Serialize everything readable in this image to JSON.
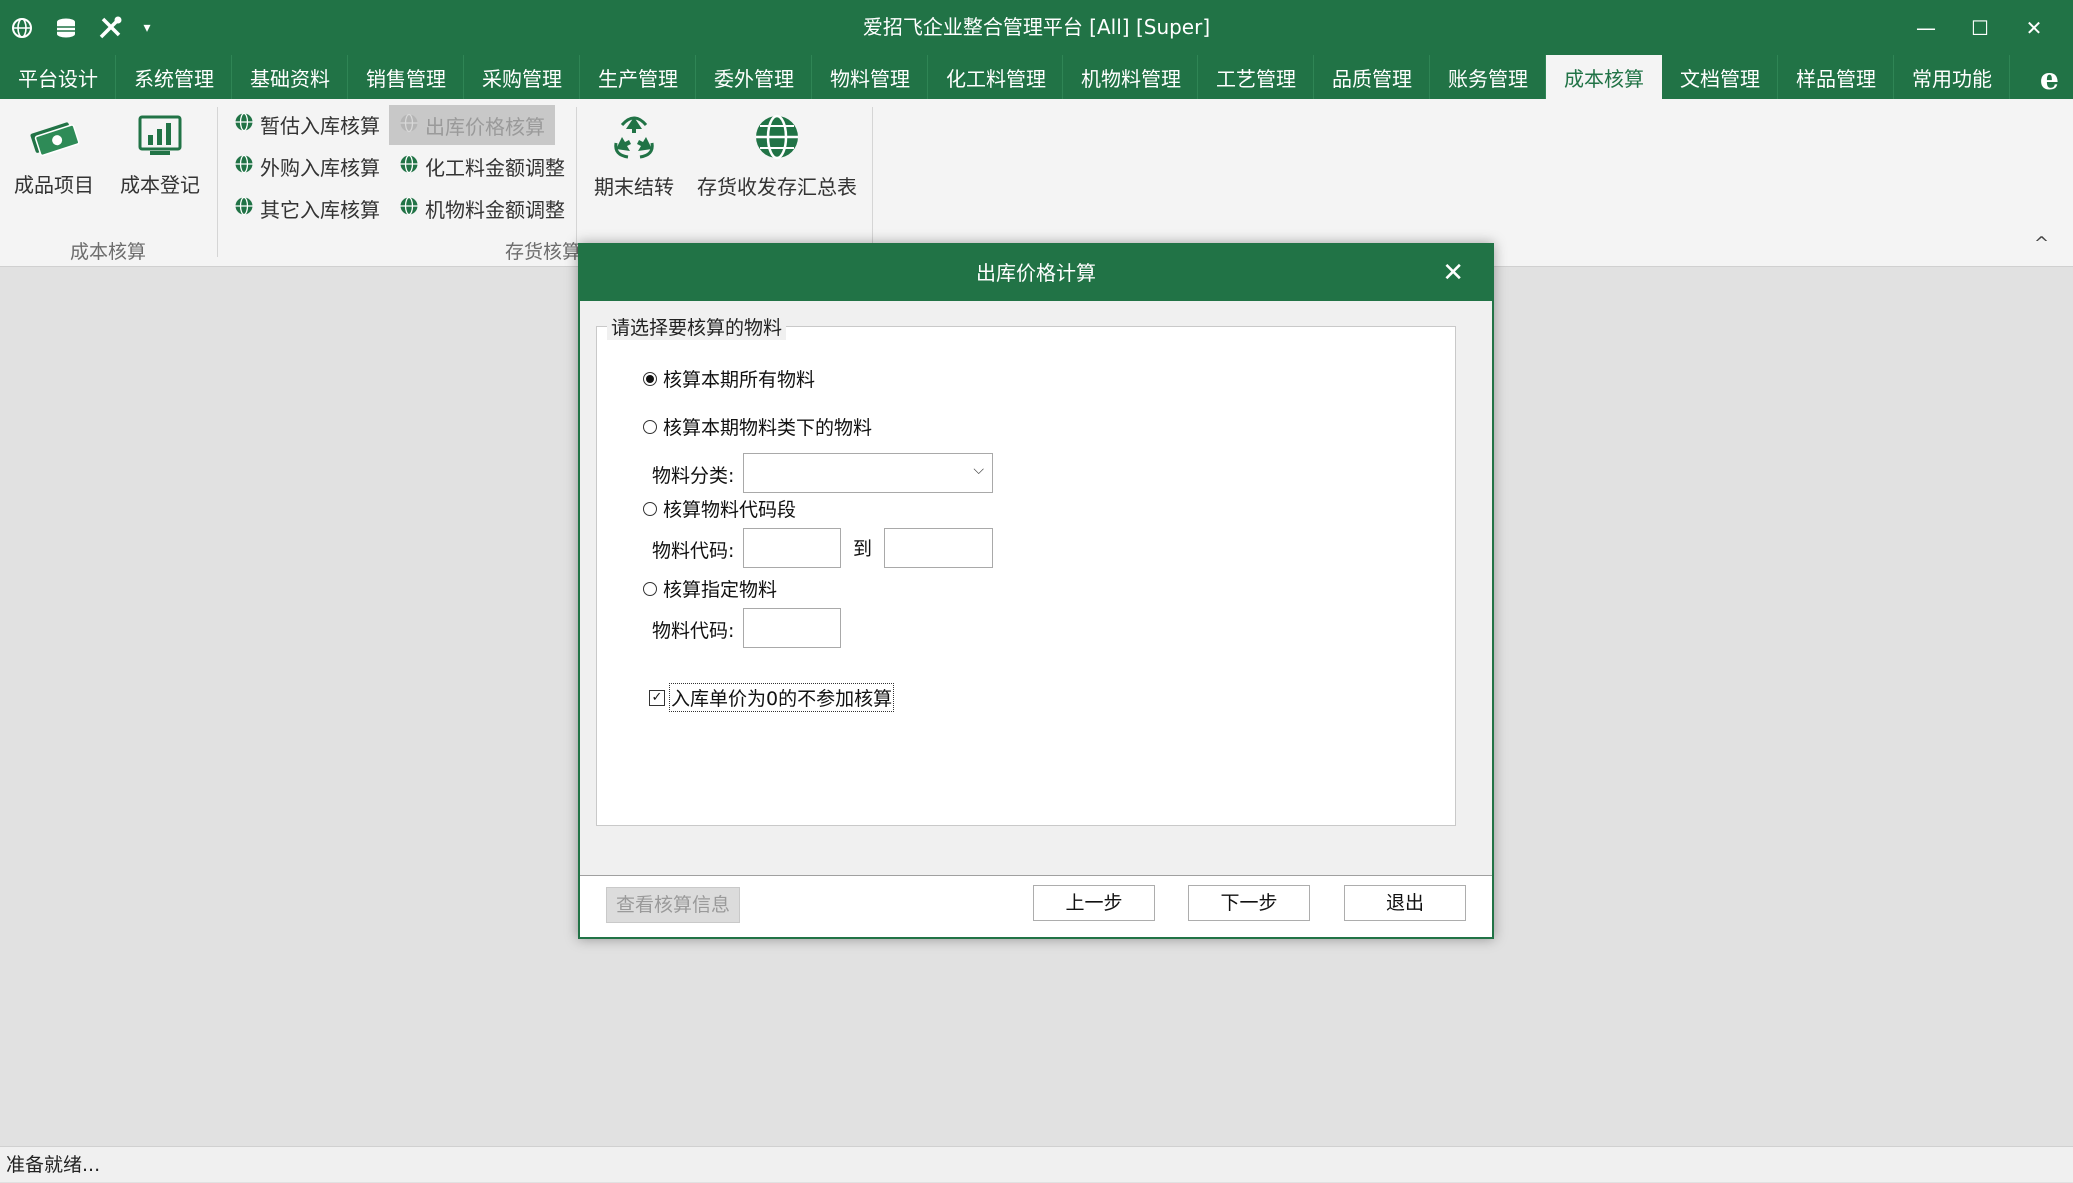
{
  "app": {
    "title": "爱招飞企业整合管理平台 [All] [Super]"
  },
  "quick_access": {
    "icons": [
      "globe-icon",
      "database-icon",
      "tools-icon",
      "customize-dropdown-icon"
    ]
  },
  "window_controls": {
    "minimize": "—",
    "maximize": "☐",
    "close": "✕"
  },
  "tabs": [
    {
      "label": "平台设计"
    },
    {
      "label": "系统管理"
    },
    {
      "label": "基础资料"
    },
    {
      "label": "销售管理"
    },
    {
      "label": "采购管理"
    },
    {
      "label": "生产管理"
    },
    {
      "label": "委外管理"
    },
    {
      "label": "物料管理"
    },
    {
      "label": "化工料管理"
    },
    {
      "label": "机物料管理"
    },
    {
      "label": "工艺管理"
    },
    {
      "label": "品质管理"
    },
    {
      "label": "账务管理"
    },
    {
      "label": "成本核算"
    },
    {
      "label": "文档管理"
    },
    {
      "label": "样品管理"
    },
    {
      "label": "常用功能"
    }
  ],
  "active_tab": "成本核算",
  "ribbon": {
    "group1": {
      "label": "成本核算",
      "buttons": [
        {
          "label": "成品项目",
          "icon": "money-icon"
        },
        {
          "label": "成本登记",
          "icon": "chart-monitor-icon"
        }
      ]
    },
    "group2": {
      "label": "存货核算",
      "col1": [
        "暂估入库核算",
        "外购入库核算",
        "其它入库核算"
      ],
      "col2": [
        "出库价格核算",
        "化工料金额调整",
        "机物料金额调整"
      ],
      "buttons": [
        {
          "label": "期末结转",
          "icon": "recycle-icon"
        },
        {
          "label": "存货收发存汇总表",
          "icon": "globe-icon"
        }
      ]
    },
    "collapse_icon": "^"
  },
  "dialog": {
    "title": "出库价格计算",
    "close": "✕",
    "groupbox_title": "请选择要核算的物料",
    "options": {
      "all": "核算本期所有物料",
      "category": "核算本期物料类下的物料",
      "code_range": "核算物料代码段",
      "specific": "核算指定物料"
    },
    "selected_option": "all",
    "category_label": "物料分类:",
    "category_value": "",
    "code_label": "物料代码:",
    "to_label": "到",
    "code_from": "",
    "code_to": "",
    "specific_code_label": "物料代码:",
    "specific_code": "",
    "checkbox_label": "入库单价为0的不参加核算",
    "checkbox_checked": true,
    "buttons": {
      "view_info": "查看核算信息",
      "prev": "上一步",
      "next": "下一步",
      "exit": "退出"
    }
  },
  "status": {
    "text": "准备就绪..."
  }
}
